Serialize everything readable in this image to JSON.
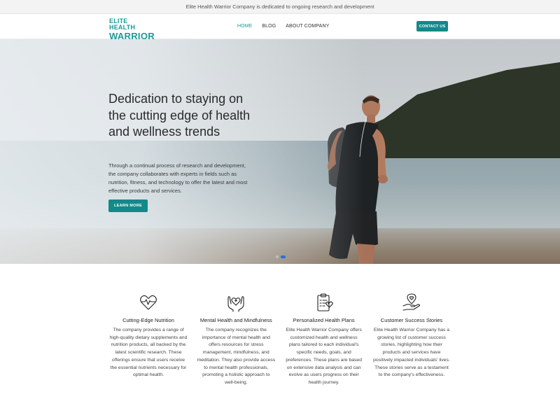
{
  "topbar": {
    "text": "Elite Health Warrior Company is dedicated to ongoing research and development"
  },
  "header": {
    "logo_line1": "ELITE HEALTH",
    "logo_line2": "WARRIOR",
    "nav": [
      {
        "label": "HOME",
        "active": true
      },
      {
        "label": "BLOG",
        "active": false
      },
      {
        "label": "ABOUT COMPANY",
        "active": false
      }
    ],
    "contact_label": "CONTACT US"
  },
  "hero": {
    "title": "Dedication to staying on the cutting edge of health and wellness trends",
    "text": "Through a continual process of research and development, the company collaborates with experts in fields such as nutrition, fitness, and technology to offer the latest and most effective products and services.",
    "button_label": "LEARN MORE",
    "slides": {
      "count": 2,
      "active": 2
    }
  },
  "features": [
    {
      "icon": "heart-pulse-icon",
      "title": "Cutting-Edge Nutrition",
      "desc": "The company provides a range of high-quality dietary supplements and nutrition products, all backed by the latest scientific research. These offerings ensure that users receive the essential nutrients necessary for optimal health."
    },
    {
      "icon": "hands-heart-icon",
      "title": "Mental Health and Mindfulness",
      "desc": "The company recognizes the importance of mental health and offers resources for stress management, mindfulness, and meditation. They also provide access to mental health professionals, promoting a holistic approach to well-being."
    },
    {
      "icon": "clipboard-health-icon",
      "title": "Personalized Health Plans",
      "desc": "Elite Health Warrior Company offers customized health and wellness plans tailored to each individual's specific needs, goals, and preferences. These plans are based on extensive data analysis and can evolve as users progress on their health journey."
    },
    {
      "icon": "hand-heart-location-icon",
      "title": "Customer Success Stories",
      "desc": "Elite Health Warrior Company has a growing list of customer success stories, highlighting how their products and services have positively impacted individuals' lives. These stories serve as a testament to the company's effectiveness."
    }
  ],
  "colors": {
    "accent": "#13898a",
    "logo": "#1a9a99",
    "slider_active": "#2f6fd4"
  }
}
